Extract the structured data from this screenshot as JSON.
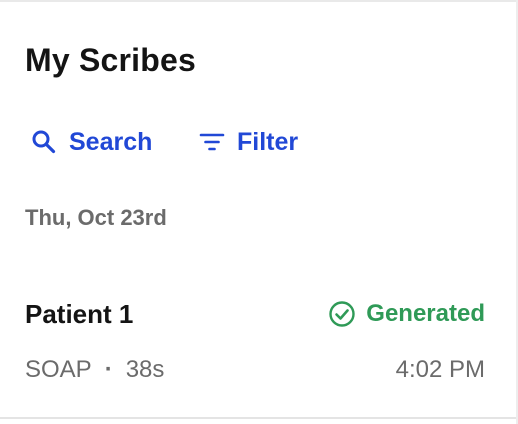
{
  "header": {
    "title": "My Scribes"
  },
  "actions": {
    "search_label": "Search",
    "search_icon": "search-icon",
    "filter_label": "Filter",
    "filter_icon": "filter-icon",
    "accent_color": "#2148d6"
  },
  "list": {
    "date_heading": "Thu, Oct 23rd",
    "items": [
      {
        "patient": "Patient 1",
        "status": "Generated",
        "status_icon": "check-circle-icon",
        "status_color": "#2f9a57",
        "note_type": "SOAP",
        "separator": "·",
        "duration": "38s",
        "time": "4:02 PM"
      }
    ]
  }
}
